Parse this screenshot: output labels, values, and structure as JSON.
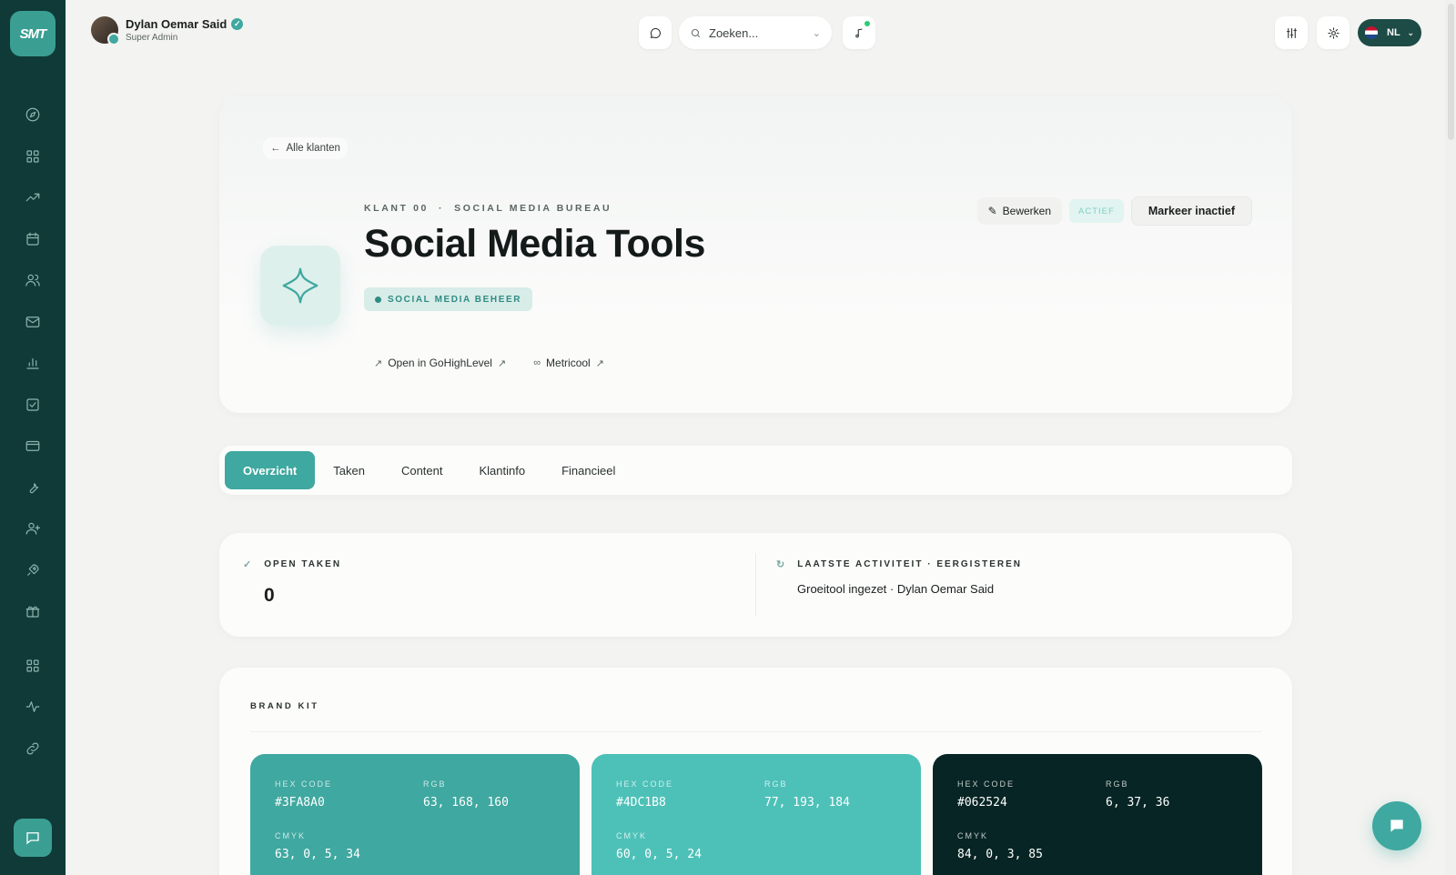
{
  "user": {
    "name": "Dylan Oemar Said",
    "role": "Super Admin"
  },
  "search": {
    "placeholder": "Zoeken..."
  },
  "language": {
    "code": "NL"
  },
  "back_link": {
    "label": "Alle klanten"
  },
  "client": {
    "eyebrow": "KLANT 00  ·  SOCIAL MEDIA BUREAU",
    "title": "Social Media Tools",
    "tag": "SOCIAL MEDIA BEHEER",
    "links": [
      {
        "label": "Open in GoHighLevel"
      },
      {
        "label": "Metricool"
      }
    ],
    "edit_label": "Bewerken",
    "status": "ACTIEF",
    "deactivate_label": "Markeer inactief"
  },
  "tabs": [
    {
      "label": "Overzicht",
      "active": true
    },
    {
      "label": "Taken"
    },
    {
      "label": "Content"
    },
    {
      "label": "Klantinfo"
    },
    {
      "label": "Financieel"
    }
  ],
  "stats": {
    "open_tasks_label": "OPEN TAKEN",
    "open_tasks_value": "0",
    "activity_label": "LAATSTE ACTIVITEIT · EERGISTEREN",
    "activity_text": "Groeitool ingezet · Dylan Oemar Said"
  },
  "brand_kit": {
    "title": "BRAND KIT",
    "labels": {
      "hex": "HEX CODE",
      "rgb": "RGB",
      "cmyk": "CMYK"
    },
    "colors": [
      {
        "hex": "#3FA8A0",
        "rgb": "63, 168, 160",
        "cmyk": "63, 0, 5, 34",
        "swatch": "#3fa8a0"
      },
      {
        "hex": "#4DC1B8",
        "rgb": "77, 193, 184",
        "cmyk": "60, 0, 5, 24",
        "swatch": "#4dc1b8"
      },
      {
        "hex": "#062524",
        "rgb": "6, 37, 36",
        "cmyk": "84, 0, 3, 85",
        "swatch": "#062524"
      }
    ]
  },
  "theme": {
    "accent": "#3fa8a0",
    "sidebar": "#0f3a37"
  }
}
